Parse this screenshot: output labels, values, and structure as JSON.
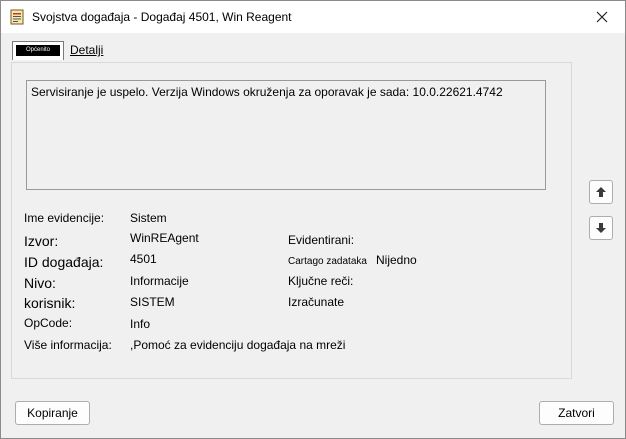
{
  "window": {
    "title": "Svojstva događaja - Događaj 4501, Win Reagent"
  },
  "tabs": [
    {
      "label": "Općenito",
      "selected": true
    },
    {
      "label": "Detalji",
      "selected": false
    }
  ],
  "description": "Servisiranje je uspelo. Verzija Windows okruženja za oporavak je sada: 10.0.22621.4742",
  "fields": {
    "log_name": {
      "label": "Ime evidencije:",
      "value": "Sistem"
    },
    "source": {
      "label": "Izvor:",
      "value": "WinREAgent"
    },
    "logged": {
      "label": "Evidentirani:",
      "value": ""
    },
    "event_id": {
      "label": "ID događaja:",
      "value": "4501"
    },
    "task_category": {
      "label": "Cartago zadataka",
      "value": "Nijedno"
    },
    "level": {
      "label": "Nivo:",
      "value": "Informacije"
    },
    "keywords": {
      "label": "Ključne reči:",
      "value": ""
    },
    "user": {
      "label": "korisnik:",
      "value": "SISTEM"
    },
    "computer": {
      "label": "Izračunate",
      "value": ""
    },
    "opcode": {
      "label": "OpCode:",
      "value": "Info"
    },
    "more_info": {
      "label": "Više informacija:",
      "value": ",Pomoć za evidenciju događaja na mreži"
    }
  },
  "buttons": {
    "copy": "Kopiranje",
    "close": "Zatvori"
  },
  "icons": {
    "app": "event-viewer-icon",
    "close": "close-icon",
    "up": "arrow-up-icon",
    "down": "arrow-down-icon"
  }
}
